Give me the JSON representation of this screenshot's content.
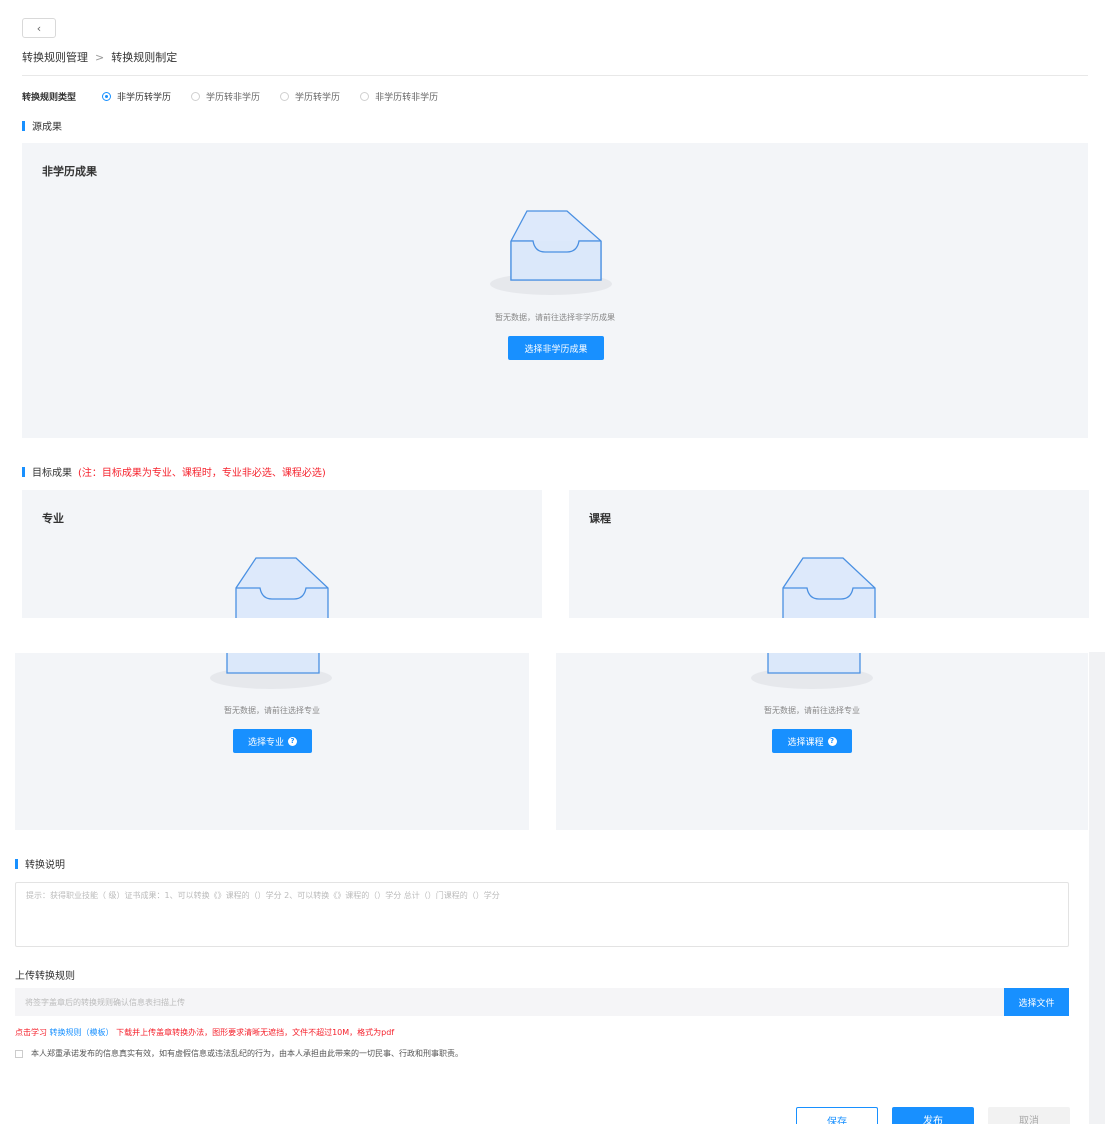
{
  "header": {
    "back_icon": "‹",
    "breadcrumb": {
      "parent": "转换规则管理",
      "separator": ">",
      "current": "转换规则制定"
    }
  },
  "rule_type": {
    "label": "转换规则类型",
    "options": [
      {
        "label": "非学历转学历",
        "checked": true
      },
      {
        "label": "学历转非学历",
        "checked": false
      },
      {
        "label": "学历转学历",
        "checked": false
      },
      {
        "label": "非学历转非学历",
        "checked": false
      }
    ]
  },
  "source": {
    "section_title": "源成果",
    "panel_title": "非学历成果",
    "empty_text": "暂无数据，请前往选择非学历成果",
    "button": "选择非学历成果"
  },
  "target": {
    "section_title": "目标成果",
    "note": "(注：目标成果为专业、课程时，专业非必选、课程必选)",
    "major": {
      "title": "专业",
      "empty_text": "暂无数据，请前往选择专业",
      "button": "选择专业"
    },
    "course": {
      "title": "课程",
      "empty_text": "暂无数据，请前往选择专业",
      "button": "选择课程"
    },
    "help_icon": "?"
  },
  "description": {
    "section_title": "转换说明",
    "placeholder": "提示：获得职业技能（  级）证书成果：1、可以转换《》课程的（）学分 2、可以转换《》课程的（）学分 总计（）门课程的（）学分"
  },
  "upload": {
    "label": "上传转换规则",
    "placeholder": "将签字盖章后的转换规则确认信息表扫描上传",
    "button": "选择文件",
    "hint_prefix": "点击学习",
    "hint_link": "转换规则（模板）",
    "hint_suffix": "下载并上传盖章转换办法，图形要求清晰无遮挡，文件不超过10M，格式为pdf"
  },
  "agreement": "本人郑重承诺发布的信息真实有效，如有虚假信息或违法乱纪的行为，由本人承担由此带来的一切民事、行政和刑事职责。",
  "footer": {
    "save": "保存",
    "publish": "发布",
    "cancel": "取消"
  },
  "colors": {
    "primary": "#1890ff",
    "danger": "#f5222d",
    "panel_bg": "#f3f5f8"
  }
}
